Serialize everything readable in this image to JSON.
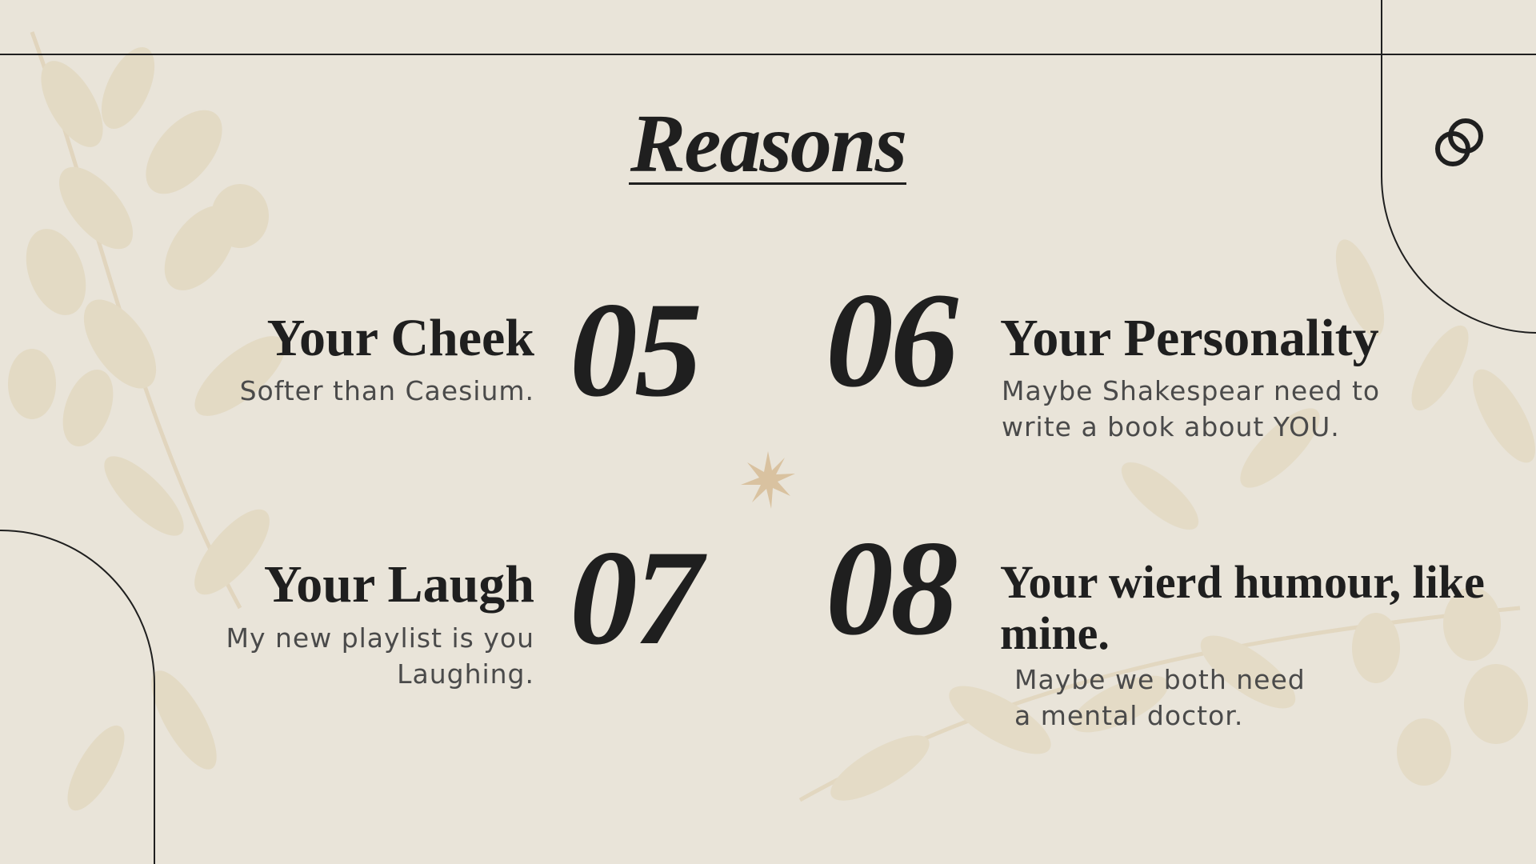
{
  "slide": {
    "title": "Reasons",
    "colors": {
      "background": "#e9e4d9",
      "ink": "#1f1f1f",
      "subtext": "#4a4a4a",
      "foliage": "#d9c9a6",
      "accent_star": "#d9c2a0"
    },
    "decorations": {
      "corner_icon": "interlocked-rings-icon",
      "center_icon": "starburst-icon"
    },
    "reasons": [
      {
        "number": "05",
        "heading": "Your Cheek",
        "description_lines": [
          "Softer than Caesium."
        ]
      },
      {
        "number": "06",
        "heading": "Your Personality",
        "description_lines": [
          "Maybe Shakespear need to",
          "write a book about YOU."
        ]
      },
      {
        "number": "07",
        "heading": "Your Laugh",
        "description_lines": [
          "My new playlist is you",
          "Laughing."
        ]
      },
      {
        "number": "08",
        "heading": "Your wierd humour, like mine.",
        "description_lines": [
          "Maybe we both need",
          "a mental doctor."
        ]
      }
    ]
  }
}
